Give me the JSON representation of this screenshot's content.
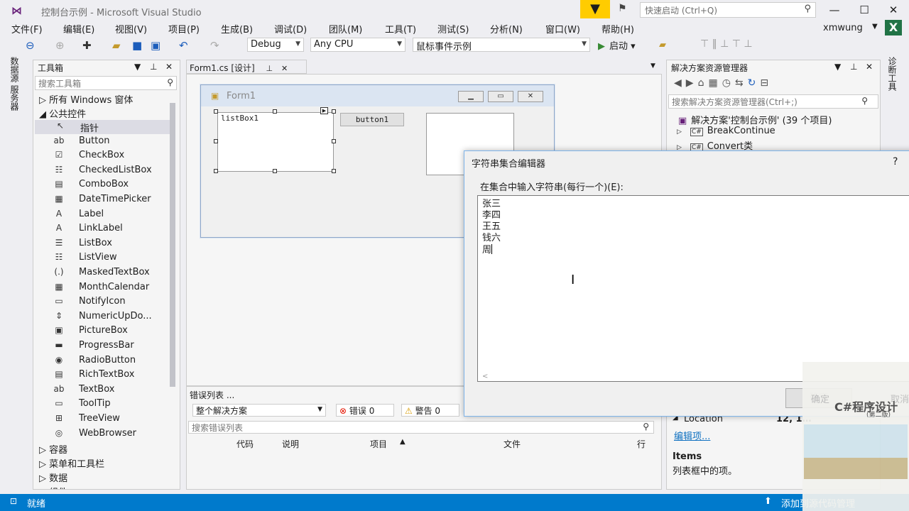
{
  "window": {
    "title": "控制台示例 - Microsoft Visual Studio",
    "quick_launch_placeholder": "快速启动 (Ctrl+Q)",
    "user": "xmwung"
  },
  "menu": [
    "文件(F)",
    "编辑(E)",
    "视图(V)",
    "项目(P)",
    "生成(B)",
    "调试(D)",
    "团队(M)",
    "工具(T)",
    "测试(S)",
    "分析(N)",
    "窗口(W)",
    "帮助(H)"
  ],
  "toolbar": {
    "config": "Debug",
    "platform": "Any CPU",
    "startup_project": "鼠标事件示例",
    "start_label": "启动"
  },
  "left_tabs": [
    "数据源",
    "服务器"
  ],
  "right_tabs": [
    "诊断工具"
  ],
  "toolbox": {
    "title": "工具箱",
    "search_placeholder": "搜索工具箱",
    "groups_top": [
      "所有 Windows 窗体",
      "公共控件"
    ],
    "items": [
      {
        "label": "指针",
        "icon": "pointer-icon",
        "glyph": "↖"
      },
      {
        "label": "Button",
        "icon": "button-icon",
        "glyph": "ab"
      },
      {
        "label": "CheckBox",
        "icon": "checkbox-icon",
        "glyph": "☑"
      },
      {
        "label": "CheckedListBox",
        "icon": "checkedlistbox-icon",
        "glyph": "☷"
      },
      {
        "label": "ComboBox",
        "icon": "combobox-icon",
        "glyph": "▤"
      },
      {
        "label": "DateTimePicker",
        "icon": "datetimepicker-icon",
        "glyph": "▦"
      },
      {
        "label": "Label",
        "icon": "label-icon",
        "glyph": "A"
      },
      {
        "label": "LinkLabel",
        "icon": "linklabel-icon",
        "glyph": "A"
      },
      {
        "label": "ListBox",
        "icon": "listbox-icon",
        "glyph": "☰"
      },
      {
        "label": "ListView",
        "icon": "listview-icon",
        "glyph": "☷"
      },
      {
        "label": "MaskedTextBox",
        "icon": "maskedtextbox-icon",
        "glyph": "(.)"
      },
      {
        "label": "MonthCalendar",
        "icon": "monthcalendar-icon",
        "glyph": "▦"
      },
      {
        "label": "NotifyIcon",
        "icon": "notifyicon-icon",
        "glyph": "▭"
      },
      {
        "label": "NumericUpDo...",
        "icon": "numericupdown-icon",
        "glyph": "⇕"
      },
      {
        "label": "PictureBox",
        "icon": "picturebox-icon",
        "glyph": "▣"
      },
      {
        "label": "ProgressBar",
        "icon": "progressbar-icon",
        "glyph": "▬"
      },
      {
        "label": "RadioButton",
        "icon": "radiobutton-icon",
        "glyph": "◉"
      },
      {
        "label": "RichTextBox",
        "icon": "richtextbox-icon",
        "glyph": "▤"
      },
      {
        "label": "TextBox",
        "icon": "textbox-icon",
        "glyph": "ab"
      },
      {
        "label": "ToolTip",
        "icon": "tooltip-icon",
        "glyph": "▭"
      },
      {
        "label": "TreeView",
        "icon": "treeview-icon",
        "glyph": "⊞"
      },
      {
        "label": "WebBrowser",
        "icon": "webbrowser-icon",
        "glyph": "◎"
      }
    ],
    "groups_bottom": [
      "容器",
      "菜单和工具栏",
      "数据",
      "组件"
    ]
  },
  "document": {
    "tab": "Form1.cs [设计]"
  },
  "form": {
    "caption": "Form1",
    "listbox": "listBox1",
    "button": "button1"
  },
  "error_list": {
    "title": "错误列表 ...",
    "scope": "整个解决方案",
    "errors": "错误 0",
    "warnings": "警告 0",
    "search_placeholder": "搜索错误列表",
    "columns": [
      "代码",
      "说明",
      "项目",
      "文件",
      "行"
    ]
  },
  "solution_explorer": {
    "title": "解决方案资源管理器",
    "search_placeholder": "搜索解决方案资源管理器(Ctrl+;)",
    "root": "解决方案'控制台示例' (39 个项目)",
    "items": [
      "BreakContinue",
      "Convert类"
    ]
  },
  "properties": {
    "location_label": "Location",
    "location_value": "12, 1…",
    "edit_link": "编辑项...",
    "items_title": "Items",
    "items_desc": "列表框中的项。"
  },
  "dialog": {
    "title": "字符串集合编辑器",
    "help": "?",
    "prompt": "在集合中输入字符串(每行一个)(E):",
    "lines": [
      "张三",
      "李四",
      "王五",
      "钱六",
      "周"
    ],
    "ok": "确定",
    "cancel": "取消"
  },
  "status": {
    "text": "就绪",
    "right": "添加到源代码管理"
  },
  "overlay_book": {
    "title": "C#程序设计",
    "edition": "(第二版)"
  }
}
